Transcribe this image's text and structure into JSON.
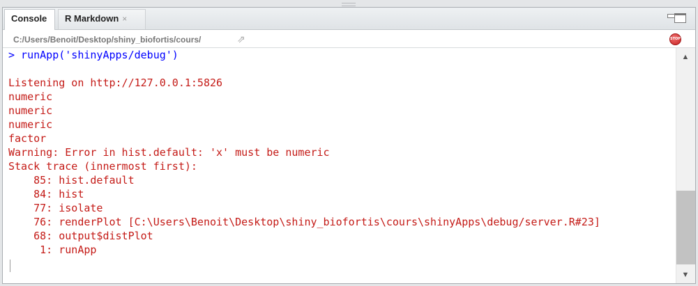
{
  "tabs": [
    {
      "label": "Console",
      "active": true
    },
    {
      "label": "R Markdown",
      "active": false,
      "close": "×"
    }
  ],
  "path": {
    "text": "C:/Users/Benoit/Desktop/shiny_biofortis/cours/",
    "arrow": "⇗"
  },
  "stop_button": {
    "label": "STOP"
  },
  "console": {
    "command": "> runApp('shinyApps/debug')",
    "output": [
      "Listening on http://127.0.0.1:5826",
      "numeric",
      "numeric",
      "numeric",
      "factor",
      "Warning: Error in hist.default: 'x' must be numeric",
      "Stack trace (innermost first):",
      "    85: hist.default",
      "    84: hist",
      "    77: isolate",
      "    76: renderPlot [C:\\Users\\Benoit\\Desktop\\shiny_biofortis\\cours\\shinyApps\\debug/server.R#23]",
      "    68: output$distPlot",
      "     1: runApp"
    ]
  },
  "colors": {
    "command": "#0000ff",
    "output": "#c41a16"
  },
  "scrollbar": {
    "up": "▲",
    "down": "▼"
  }
}
